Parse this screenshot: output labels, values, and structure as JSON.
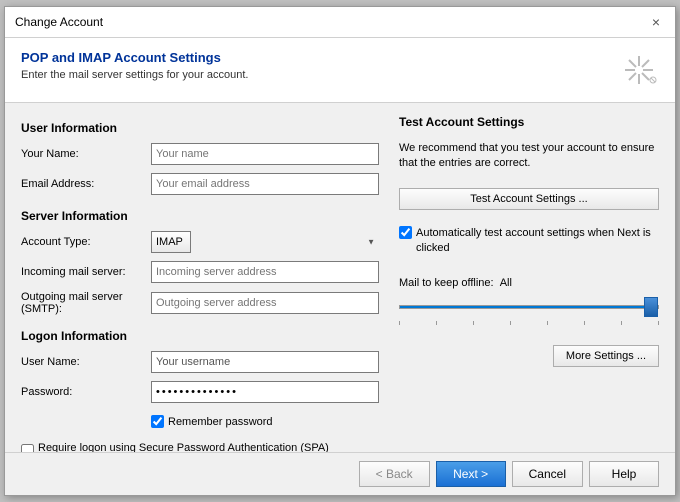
{
  "window": {
    "title": "Change Account",
    "close_button": "×"
  },
  "header": {
    "title": "POP and IMAP Account Settings",
    "description": "Enter the mail server settings for your account.",
    "icon": "✳"
  },
  "left": {
    "user_info_title": "User Information",
    "your_name_label": "Your Name:",
    "your_name_placeholder": "Your name",
    "email_label": "Email Address:",
    "email_placeholder": "Your email address",
    "server_info_title": "Server Information",
    "account_type_label": "Account Type:",
    "account_type_value": "IMAP",
    "incoming_mail_label": "Incoming mail server:",
    "incoming_mail_placeholder": "Incoming server address",
    "outgoing_mail_label": "Outgoing mail server (SMTP):",
    "outgoing_mail_placeholder": "Outgoing server address",
    "logon_info_title": "Logon Information",
    "username_label": "User Name:",
    "username_value": "Your username",
    "password_label": "Password:",
    "password_value": "**************",
    "remember_password_label": "Remember password",
    "spa_label": "Require logon using Secure Password Authentication (SPA)"
  },
  "right": {
    "title": "Test Account Settings",
    "description": "We recommend that you test your account to ensure that the entries are correct.",
    "test_button_label": "Test Account Settings ...",
    "auto_test_label": "Automatically test account settings when Next is clicked",
    "mail_keep_label": "Mail to keep offline:",
    "mail_keep_value": "All",
    "more_settings_label": "More Settings ..."
  },
  "footer": {
    "back_label": "< Back",
    "next_label": "Next >",
    "cancel_label": "Cancel",
    "help_label": "Help"
  }
}
